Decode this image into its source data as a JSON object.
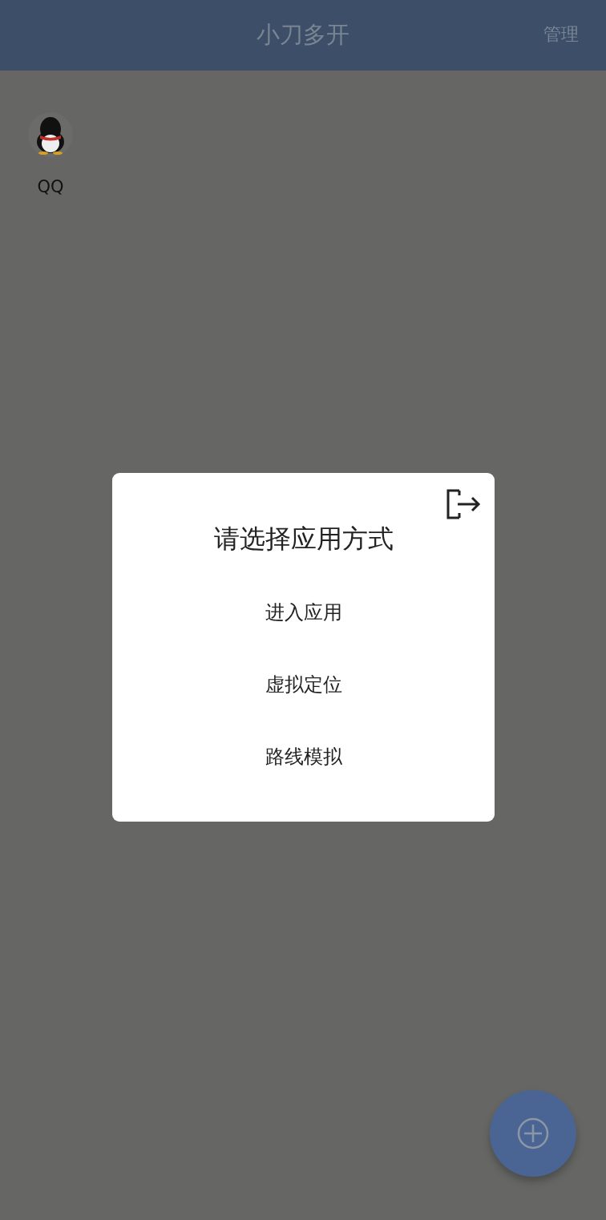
{
  "header": {
    "title": "小刀多开",
    "action": "管理"
  },
  "apps": [
    {
      "label": "QQ"
    }
  ],
  "dialog": {
    "title": "请选择应用方式",
    "options": [
      "进入应用",
      "虚拟定位",
      "路线模拟"
    ]
  }
}
